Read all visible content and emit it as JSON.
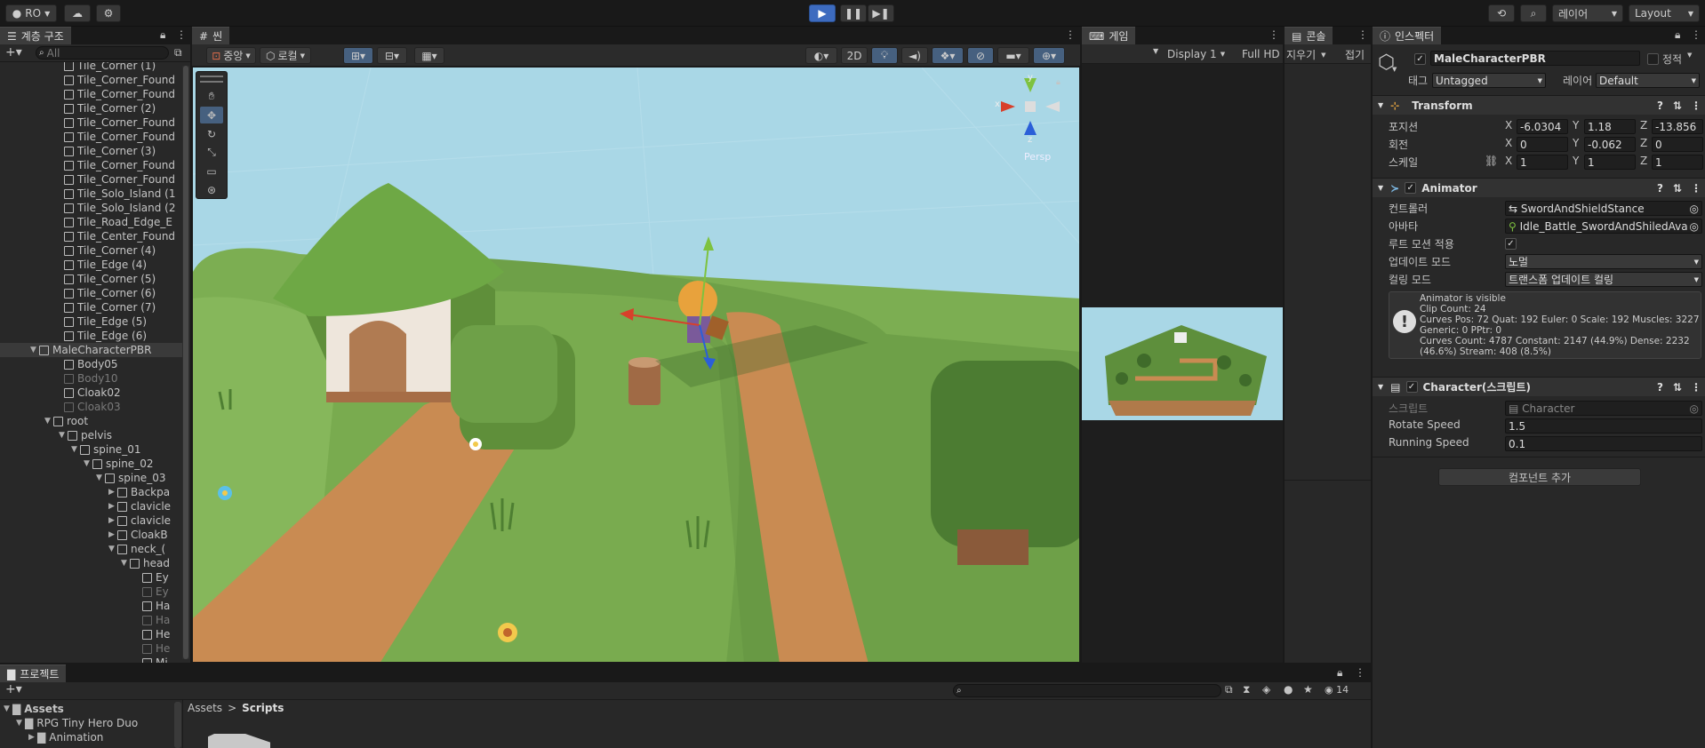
{
  "toolbar": {
    "account": "RO",
    "layers": "레이어",
    "layout": "Layout"
  },
  "hierarchy": {
    "tab": "계층 구조",
    "search_placeholder": "All",
    "items": [
      {
        "label": "Tile_Corner (1)",
        "depth": 0,
        "dim": false
      },
      {
        "label": "Tile_Corner_Found",
        "depth": 0,
        "dim": false
      },
      {
        "label": "Tile_Corner_Found",
        "depth": 0,
        "dim": false
      },
      {
        "label": "Tile_Corner (2)",
        "depth": 0,
        "dim": false
      },
      {
        "label": "Tile_Corner_Found",
        "depth": 0,
        "dim": false
      },
      {
        "label": "Tile_Corner_Found",
        "depth": 0,
        "dim": false
      },
      {
        "label": "Tile_Corner (3)",
        "depth": 0,
        "dim": false
      },
      {
        "label": "Tile_Corner_Found",
        "depth": 0,
        "dim": false
      },
      {
        "label": "Tile_Corner_Found",
        "depth": 0,
        "dim": false
      },
      {
        "label": "Tile_Solo_Island (1",
        "depth": 0,
        "dim": false
      },
      {
        "label": "Tile_Solo_Island (2",
        "depth": 0,
        "dim": false
      },
      {
        "label": "Tile_Road_Edge_E",
        "depth": 0,
        "dim": false
      },
      {
        "label": "Tile_Center_Found",
        "depth": 0,
        "dim": false
      },
      {
        "label": "Tile_Corner (4)",
        "depth": 0,
        "dim": false
      },
      {
        "label": "Tile_Edge (4)",
        "depth": 0,
        "dim": false
      },
      {
        "label": "Tile_Corner (5)",
        "depth": 0,
        "dim": false
      },
      {
        "label": "Tile_Corner (6)",
        "depth": 0,
        "dim": false
      },
      {
        "label": "Tile_Corner (7)",
        "depth": 0,
        "dim": false
      },
      {
        "label": "Tile_Edge (5)",
        "depth": 0,
        "dim": false
      },
      {
        "label": "Tile_Edge (6)",
        "depth": 0,
        "dim": false
      },
      {
        "label": "MaleCharacterPBR",
        "depth": -1,
        "dim": false,
        "selected": true,
        "open": true
      },
      {
        "label": "Body05",
        "depth": 0,
        "dim": false
      },
      {
        "label": "Body10",
        "depth": 0,
        "dim": true
      },
      {
        "label": "Cloak02",
        "depth": 0,
        "dim": false
      },
      {
        "label": "Cloak03",
        "depth": 0,
        "dim": true
      },
      {
        "label": "root",
        "depth": 0,
        "dim": false,
        "open": true,
        "nocube": true
      },
      {
        "label": "pelvis",
        "depth": 1,
        "dim": false,
        "open": true
      },
      {
        "label": "spine_01",
        "depth": 2,
        "dim": false,
        "open": true
      },
      {
        "label": "spine_02",
        "depth": 3,
        "dim": false,
        "open": true
      },
      {
        "label": "spine_03",
        "depth": 4,
        "dim": false,
        "open": true
      },
      {
        "label": "Backpa",
        "depth": 5,
        "dim": false,
        "closed": true
      },
      {
        "label": "clavicle",
        "depth": 5,
        "dim": false,
        "closed": true
      },
      {
        "label": "clavicle",
        "depth": 5,
        "dim": false,
        "closed": true
      },
      {
        "label": "CloakB",
        "depth": 5,
        "dim": false,
        "closed": true
      },
      {
        "label": "neck_(",
        "depth": 5,
        "dim": false,
        "open": true
      },
      {
        "label": "head",
        "depth": 6,
        "dim": false,
        "open": true
      },
      {
        "label": "Ey",
        "depth": 7,
        "dim": false
      },
      {
        "label": "Ey",
        "depth": 7,
        "dim": true
      },
      {
        "label": "Ha",
        "depth": 7,
        "dim": false
      },
      {
        "label": "Ha",
        "depth": 7,
        "dim": true
      },
      {
        "label": "He",
        "depth": 7,
        "dim": false
      },
      {
        "label": "He",
        "depth": 7,
        "dim": true
      },
      {
        "label": "Mi",
        "depth": 7,
        "dim": false
      }
    ]
  },
  "scene": {
    "tab": "씬",
    "pivot": "중앙",
    "space": "로컬",
    "mode2d": "2D",
    "persp": "Persp",
    "gizmo_x": "x",
    "gizmo_y": "y",
    "gizmo_z": "z"
  },
  "game": {
    "tab": "게임",
    "display": "Display 1",
    "resolution": "Full HD"
  },
  "console": {
    "tab": "콘솔",
    "clear": "지우기",
    "collapse": "접기"
  },
  "inspector": {
    "tab": "인스펙터",
    "object_name": "MaleCharacterPBR",
    "static_label": "정적",
    "tag_label": "태그",
    "tag_value": "Untagged",
    "layer_label": "레이어",
    "layer_value": "Default",
    "transform": {
      "title": "Transform",
      "position_label": "포지션",
      "rotation_label": "회전",
      "scale_label": "스케일",
      "px": "-6.0304",
      "py": "1.18",
      "pz": "-13.856",
      "rx": "0",
      "ry": "-0.062",
      "rz": "0",
      "sx": "1",
      "sy": "1",
      "sz": "1",
      "x": "X",
      "y": "Y",
      "z": "Z"
    },
    "animator": {
      "title": "Animator",
      "controller_label": "컨트롤러",
      "controller_value": "SwordAndShieldStance",
      "avatar_label": "아바타",
      "avatar_value": "Idle_Battle_SwordAndShiledAva",
      "root_motion_label": "루트 모션 적용",
      "update_mode_label": "업데이트 모드",
      "update_mode_value": "노멀",
      "culling_label": "컬링 모드",
      "culling_value": "트랜스폼 업데이트 컬링",
      "info_lines": [
        "Animator is visible",
        "Clip Count: 24",
        "Curves Pos: 72 Quat: 192 Euler: 0 Scale: 192 Muscles: 3227",
        "Generic: 0 PPtr: 0",
        "Curves Count: 4787 Constant: 2147 (44.9%) Dense: 2232",
        "(46.6%) Stream: 408 (8.5%)"
      ]
    },
    "character": {
      "title": "Character(스크립트)",
      "script_label": "스크립트",
      "script_value": "Character",
      "rotate_label": "Rotate Speed",
      "rotate_value": "1.5",
      "running_label": "Running Speed",
      "running_value": "0.1"
    },
    "add_component": "컴포넌트 추가"
  },
  "project": {
    "tab": "프로젝트",
    "count": "14",
    "breadcrumb_root": "Assets",
    "breadcrumb_current": "Scripts",
    "tree": [
      "Assets",
      "RPG Tiny Hero Duo",
      "Animation"
    ]
  },
  "colors": {
    "sky": "#a9d7e6",
    "grass": "#6ea048",
    "path": "#c98b52",
    "selection": "#3a3a3a",
    "accent": "#3d6bbf"
  }
}
